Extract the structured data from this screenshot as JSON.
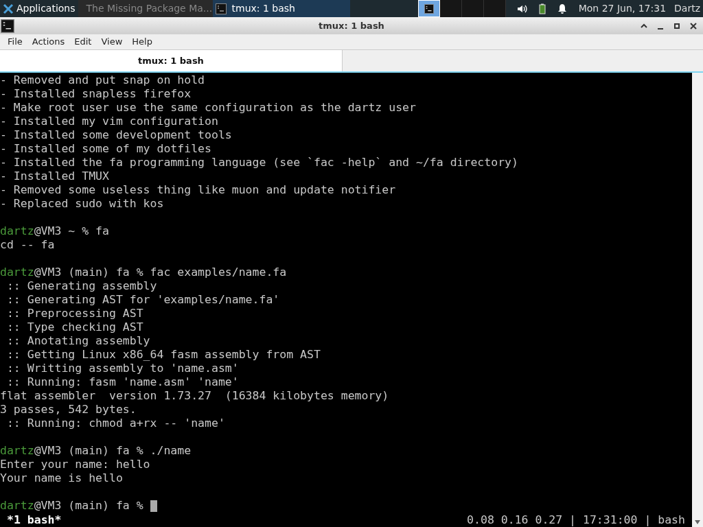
{
  "taskbar": {
    "apps_label": "Applications",
    "tasks": [
      {
        "title": "The Missing Package Ma...",
        "kind": "browser",
        "selected": false
      },
      {
        "title": "tmux: 1 bash",
        "kind": "terminal",
        "selected": true
      }
    ],
    "desktops": [
      {
        "selected": true,
        "has_window": true
      },
      {
        "selected": false,
        "has_window": false
      },
      {
        "selected": false,
        "has_window": false
      },
      {
        "selected": false,
        "has_window": false
      }
    ],
    "clock": "Mon 27 Jun, 17:31",
    "user": "Dartz"
  },
  "window": {
    "title": "tmux: 1 bash"
  },
  "menu": [
    "File",
    "Actions",
    "Edit",
    "View",
    "Help"
  ],
  "tabs": [
    {
      "label": "tmux: 1 bash",
      "selected": true
    }
  ],
  "terminal": {
    "lines": [
      {
        "kind": "output",
        "text": "- Removed and put snap on hold"
      },
      {
        "kind": "output",
        "text": "- Installed snapless firefox"
      },
      {
        "kind": "output",
        "text": "- Make root user use the same configuration as the dartz user"
      },
      {
        "kind": "output",
        "text": "- Installed my vim configuration"
      },
      {
        "kind": "output",
        "text": "- Installed some development tools"
      },
      {
        "kind": "output",
        "text": "- Installed some of my dotfiles"
      },
      {
        "kind": "output",
        "text": "- Installed the fa programming language (see `fac -help` and ~/fa directory)"
      },
      {
        "kind": "output",
        "text": "- Installed TMUX"
      },
      {
        "kind": "output",
        "text": "- Removed some useless thing like muon and update notifier"
      },
      {
        "kind": "output",
        "text": "- Replaced sudo with kos"
      },
      {
        "kind": "blank"
      },
      {
        "kind": "prompt",
        "user": "dartz",
        "text": "@VM3 ~ % fa"
      },
      {
        "kind": "output",
        "text": "cd -- fa"
      },
      {
        "kind": "blank"
      },
      {
        "kind": "prompt",
        "user": "dartz",
        "text": "@VM3 (main) fa % fac examples/name.fa"
      },
      {
        "kind": "output",
        "text": " :: Generating assembly"
      },
      {
        "kind": "output",
        "text": " :: Generating AST for 'examples/name.fa'"
      },
      {
        "kind": "output",
        "text": " :: Preprocessing AST"
      },
      {
        "kind": "output",
        "text": " :: Type checking AST"
      },
      {
        "kind": "output",
        "text": " :: Anotating assembly"
      },
      {
        "kind": "output",
        "text": " :: Getting Linux x86_64 fasm assembly from AST"
      },
      {
        "kind": "output",
        "text": " :: Writting assembly to 'name.asm'"
      },
      {
        "kind": "output",
        "text": " :: Running: fasm 'name.asm' 'name'"
      },
      {
        "kind": "output",
        "text": "flat assembler  version 1.73.27  (16384 kilobytes memory)"
      },
      {
        "kind": "output",
        "text": "3 passes, 542 bytes."
      },
      {
        "kind": "output",
        "text": " :: Running: chmod a+rx -- 'name'"
      },
      {
        "kind": "blank"
      },
      {
        "kind": "prompt",
        "user": "dartz",
        "text": "@VM3 (main) fa % ./name"
      },
      {
        "kind": "output",
        "text": "Enter your name: hello"
      },
      {
        "kind": "output",
        "text": "Your name is hello"
      },
      {
        "kind": "blank"
      },
      {
        "kind": "prompt",
        "user": "dartz",
        "text": "@VM3 (main) fa % ",
        "cursor": true
      }
    ],
    "status_left": "*1 bash*",
    "status_right": "0.08 0.16 0.27 | 17:31:00 | bash"
  }
}
